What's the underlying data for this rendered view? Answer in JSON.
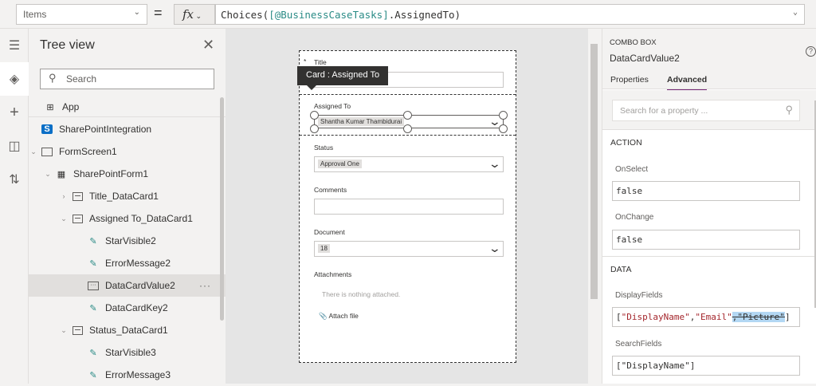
{
  "formula_bar": {
    "property": "Items",
    "equals": "=",
    "fx_label": "fx",
    "formula_prefix": "Choices(",
    "formula_id": "[@BusinessCaseTasks]",
    "formula_suffix": ".AssignedTo)"
  },
  "tree": {
    "title": "Tree view",
    "search_placeholder": "Search",
    "items": [
      {
        "label": "App"
      },
      {
        "label": "SharePointIntegration"
      },
      {
        "label": "FormScreen1"
      },
      {
        "label": "SharePointForm1"
      },
      {
        "label": "Title_DataCard1"
      },
      {
        "label": "Assigned To_DataCard1"
      },
      {
        "label": "StarVisible2"
      },
      {
        "label": "ErrorMessage2"
      },
      {
        "label": "DataCardValue2"
      },
      {
        "label": "DataCardKey2"
      },
      {
        "label": "Status_DataCard1"
      },
      {
        "label": "StarVisible3"
      },
      {
        "label": "ErrorMessage3"
      }
    ],
    "more_label": "···",
    "sp_icon_letter": "S"
  },
  "form": {
    "tooltip": "Card : Assigned To",
    "required_mark": "*",
    "title_label": "Title",
    "assigned_label": "Assigned To",
    "assigned_value": "Shantha Kumar Thambidurai",
    "status_label": "Status",
    "status_value": "Approval One",
    "comments_label": "Comments",
    "document_label": "Document",
    "document_value": "18",
    "attachments_label": "Attachments",
    "attachments_empty": "There is nothing attached.",
    "attach_file": "Attach file"
  },
  "right_panel": {
    "control_type": "COMBO BOX",
    "control_name": "DataCardValue2",
    "tabs": [
      "Properties",
      "Advanced"
    ],
    "search_placeholder": "Search for a property ...",
    "action_section": "ACTION",
    "onselect_label": "OnSelect",
    "onselect_value": "false",
    "onchange_label": "OnChange",
    "onchange_value": "false",
    "data_section": "DATA",
    "displayfields_label": "DisplayFields",
    "displayfields_open": "[",
    "displayfields_s1": "\"DisplayName\"",
    "displayfields_comma": ",",
    "displayfields_s2": "\"Email\"",
    "displayfields_sel": ",\"Picture\"",
    "displayfields_close": "]",
    "searchfields_label": "SearchFields",
    "searchfields_value": "[\"DisplayName\"]"
  }
}
